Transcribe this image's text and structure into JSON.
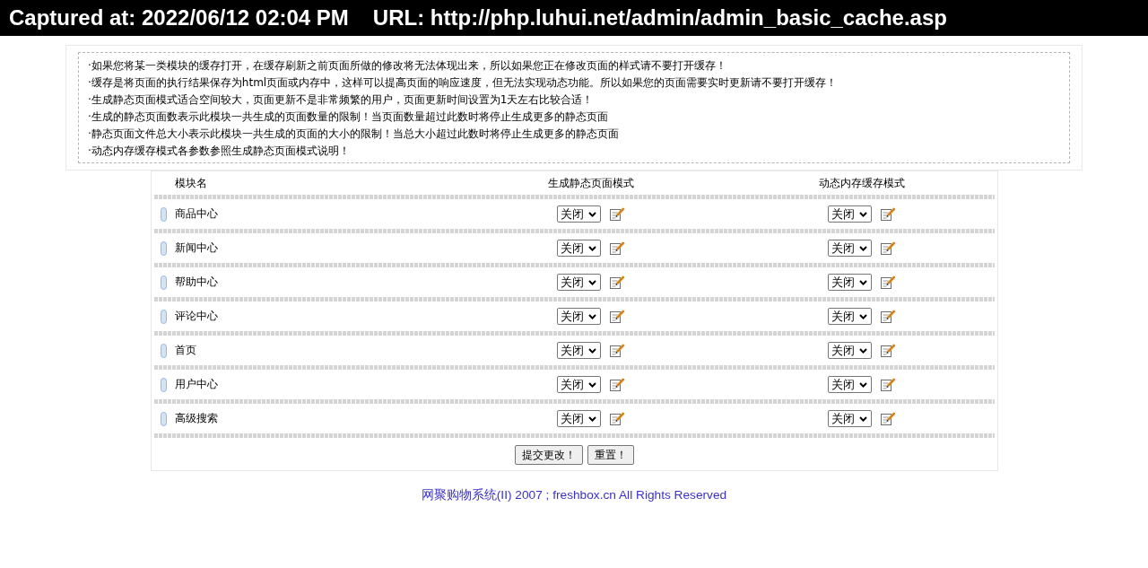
{
  "capture_bar": {
    "captured": "Captured at: 2022/06/12 02:04 PM",
    "url": "URL: http://php.luhui.net/admin/admin_basic_cache.asp"
  },
  "notes": [
    "·如果您将某一类模块的缓存打开，在缓存刷新之前页面所做的修改将无法体现出来，所以如果您正在修改页面的样式请不要打开缓存！",
    "·缓存是将页面的执行结果保存为html页面或内存中，这样可以提高页面的响应速度，但无法实现动态功能。所以如果您的页面需要实时更新请不要打开缓存！",
    "·生成静态页面模式适合空间较大，页面更新不是非常频繁的用户，页面更新时间设置为1天左右比较合适！",
    "·生成的静态页面数表示此模块一共生成的页面数量的限制！当页面数量超过此数时将停止生成更多的静态页面",
    "·静态页面文件总大小表示此模块一共生成的页面的大小的限制！当总大小超过此数时将停止生成更多的静态页面",
    "·动态内存缓存模式各参数参照生成静态页面模式说明！"
  ],
  "table": {
    "columns": [
      "模块名",
      "生成静态页面模式",
      "动态内存缓存模式"
    ],
    "rows": [
      {
        "name": "商品中心",
        "static_mode": "关闭",
        "memory_mode": "关闭"
      },
      {
        "name": "新闻中心",
        "static_mode": "关闭",
        "memory_mode": "关闭"
      },
      {
        "name": "帮助中心",
        "static_mode": "关闭",
        "memory_mode": "关闭"
      },
      {
        "name": "评论中心",
        "static_mode": "关闭",
        "memory_mode": "关闭"
      },
      {
        "name": "首页",
        "static_mode": "关闭",
        "memory_mode": "关闭"
      },
      {
        "name": "用户中心",
        "static_mode": "关闭",
        "memory_mode": "关闭"
      },
      {
        "name": "高级搜索",
        "static_mode": "关闭",
        "memory_mode": "关闭"
      }
    ]
  },
  "buttons": [
    "提交更改！",
    "重置！"
  ],
  "footer": "网聚购物系统(II) 2007 ; freshbox.cn All Rights Reserved"
}
